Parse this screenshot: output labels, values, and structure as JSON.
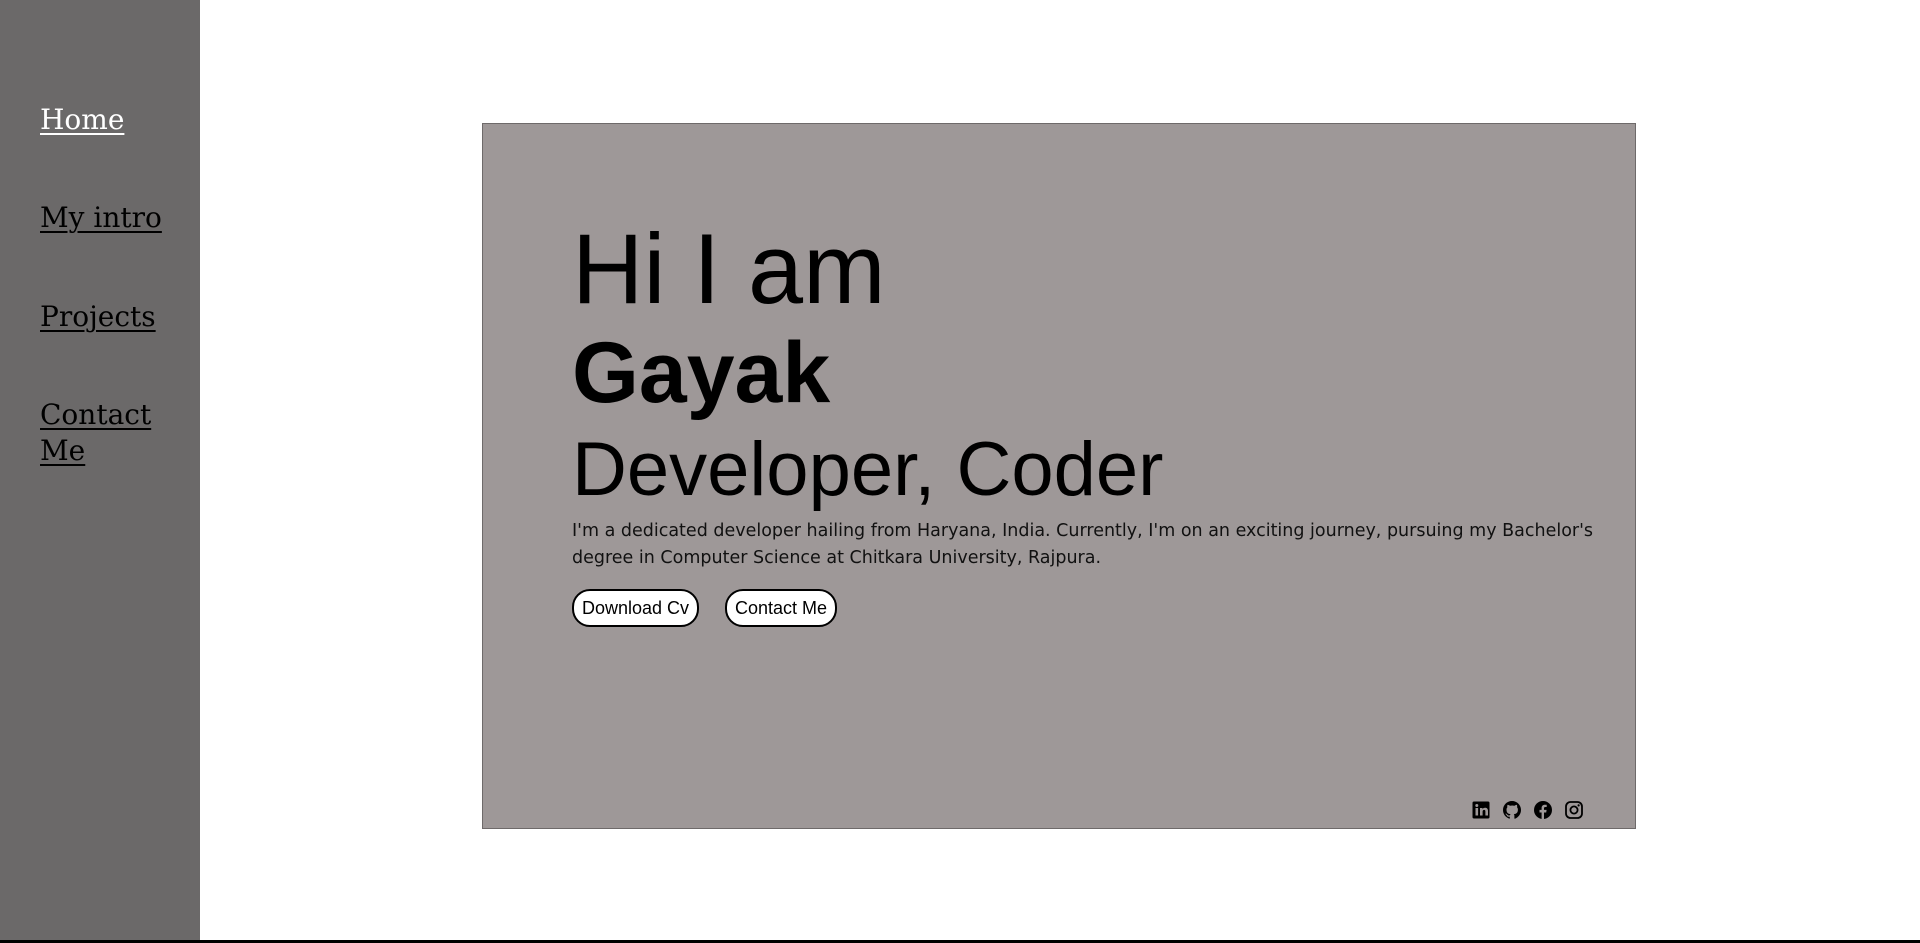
{
  "sidebar": {
    "items": [
      {
        "label": "Home",
        "active": true
      },
      {
        "label": "My intro",
        "active": false
      },
      {
        "label": "Projects",
        "active": false
      },
      {
        "label": "Contact Me",
        "active": false
      }
    ]
  },
  "hero": {
    "greeting": "Hi I am",
    "name": "Gayak",
    "roles": "Developer, Coder",
    "description": "I'm a dedicated developer hailing from Haryana, India. Currently, I'm on an exciting journey, pursuing my Bachelor's degree in Computer Science at Chitkara University, Rajpura.",
    "buttons": {
      "download_label": "Download Cv",
      "contact_label": "Contact Me"
    }
  },
  "socials": [
    {
      "icon": "linkedin-icon"
    },
    {
      "icon": "github-icon"
    },
    {
      "icon": "facebook-icon"
    },
    {
      "icon": "instagram-icon"
    }
  ],
  "colors": {
    "sidebar_bg": "#6b6969",
    "card_bg": "#9e9898",
    "active_link": "#ffffff",
    "link": "#000000"
  }
}
